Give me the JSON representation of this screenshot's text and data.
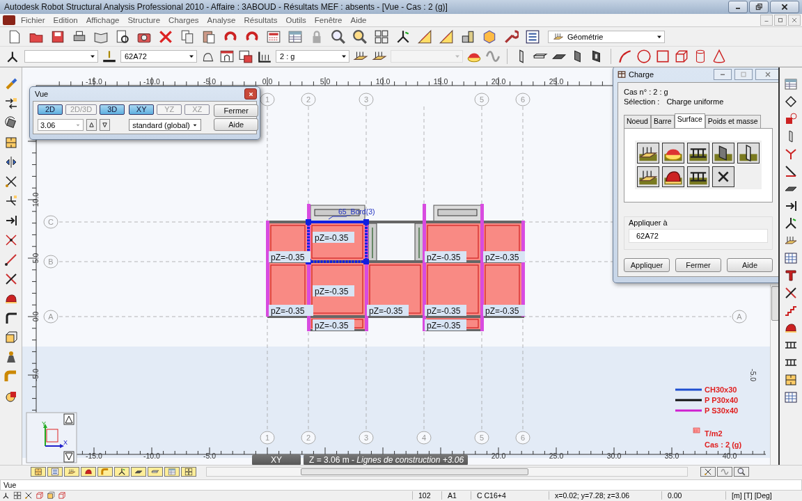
{
  "window": {
    "title": "Autodesk Robot Structural Analysis Professional 2010 - Affaire : 3ABOUD - Résultats MEF : absents - [Vue - Cas : 2 (g)]"
  },
  "menu": [
    "Fichier",
    "Edition",
    "Affichage",
    "Structure",
    "Charges",
    "Analyse",
    "Résultats",
    "Outils",
    "Fenêtre",
    "Aide"
  ],
  "toolbar": {
    "view_mode": "Géométrie",
    "selection": "62A72",
    "load_case": "2 : g"
  },
  "canvas": {
    "top_ruler": [
      "-15.0",
      "-10.0",
      "-5.0",
      "0.0",
      "5.0",
      "10.0",
      "15.0",
      "20.0",
      "25.0"
    ],
    "bottom_ruler": [
      "-15.0",
      "-10.0",
      "-5.0",
      "20.0",
      "25.0",
      "30.0",
      "35.0",
      "40.0"
    ],
    "left_ruler": [
      "10.0",
      "5.0",
      "0.0",
      "-5.0"
    ],
    "right_ruler": [
      "-5.0"
    ],
    "top_axes": [
      "1",
      "2",
      "3",
      "5",
      "6"
    ],
    "bottom_axes": [
      "1",
      "2",
      "3",
      "4",
      "5",
      "6"
    ],
    "row_axes": [
      "C",
      "B",
      "A"
    ],
    "right_row_axes": [
      "A"
    ],
    "edge_label": "65_Bord(3)",
    "loads": [
      "pZ=-0.35",
      "pZ=-0.35",
      "pZ=-0.35",
      "pZ=-0.35",
      "pZ=-0.35",
      "pZ=-0.35",
      "pZ=-0.35",
      "pZ=-0.35",
      "pZ=-0.35",
      "pZ=-0.35",
      "pZ=-0.35"
    ],
    "legend": [
      {
        "label": "CH30x30",
        "color": "#1f4fd0"
      },
      {
        "label": "P P30x40",
        "color": "#101010"
      },
      {
        "label": "P S30x40",
        "color": "#d020d0"
      }
    ],
    "axis_names": {
      "y": "Y",
      "x": "X"
    },
    "units": "T/m2",
    "case": "Cas : 2 (g)",
    "view_plane": "XY",
    "level_info": "Z = 3.06 m - *Lignes de construction +3.06*"
  },
  "vue_dialog": {
    "title": "Vue",
    "modes": [
      {
        "label": "2D",
        "selected": true
      },
      {
        "label": "2D/3D",
        "selected": false
      },
      {
        "label": "3D",
        "selected": true
      }
    ],
    "planes": [
      {
        "label": "XY",
        "selected": true
      },
      {
        "label": "YZ",
        "selected": false
      },
      {
        "label": "XZ",
        "selected": false
      }
    ],
    "level": "3.06",
    "system": "standard (global)",
    "buttons": [
      "Fermer",
      "Aide"
    ]
  },
  "charge_dialog": {
    "title": "Charge",
    "case": "Cas n° : 2 : g",
    "selection_label": "Sélection :",
    "selection": "Charge uniforme",
    "tabs": [
      {
        "label": "Noeud",
        "selected": false
      },
      {
        "label": "Barre",
        "selected": false
      },
      {
        "label": "Surface",
        "selected": true
      },
      {
        "label": "Poids et masse",
        "selected": false
      }
    ],
    "apply_label": "Appliquer à",
    "apply_to": "62A72",
    "buttons": [
      "Appliquer",
      "Fermer",
      "Aide"
    ]
  },
  "status": {
    "command": "Vue",
    "fields": [
      "102",
      "A1",
      "C C16+4",
      "x=0.02; y=7.28; z=3.06",
      "0.00",
      "[m] [T] [Deg]"
    ]
  }
}
